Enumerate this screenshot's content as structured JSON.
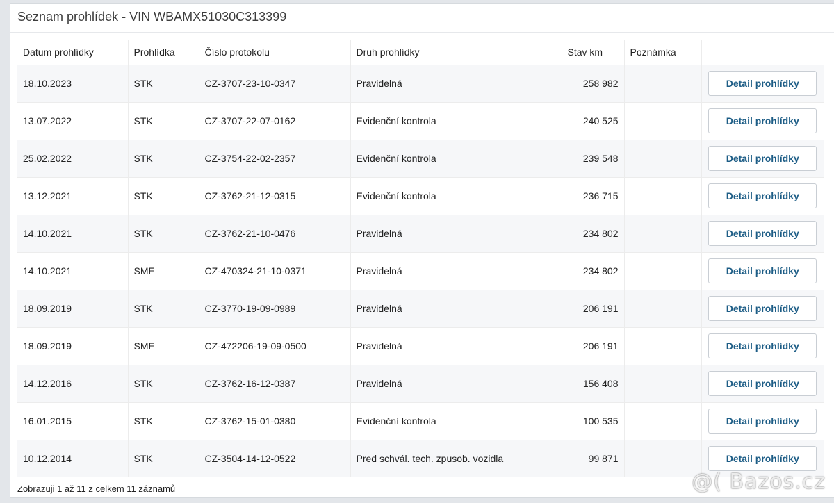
{
  "panel": {
    "title": "Seznam prohlídek - VIN WBAMX51030C313399"
  },
  "table": {
    "headers": [
      "Datum prohlídky",
      "Prohlídka",
      "Číslo protokolu",
      "Druh prohlídky",
      "Stav km",
      "Poznámka",
      ""
    ],
    "rows": [
      {
        "date": "18.10.2023",
        "type": "STK",
        "protocol": "CZ-3707-23-10-0347",
        "kind": "Pravidelná",
        "km": "258 982",
        "note": "",
        "action": "Detail prohlídky"
      },
      {
        "date": "13.07.2022",
        "type": "STK",
        "protocol": "CZ-3707-22-07-0162",
        "kind": "Evidenční kontrola",
        "km": "240 525",
        "note": "",
        "action": "Detail prohlídky"
      },
      {
        "date": "25.02.2022",
        "type": "STK",
        "protocol": "CZ-3754-22-02-2357",
        "kind": "Evidenční kontrola",
        "km": "239 548",
        "note": "",
        "action": "Detail prohlídky"
      },
      {
        "date": "13.12.2021",
        "type": "STK",
        "protocol": "CZ-3762-21-12-0315",
        "kind": "Evidenční kontrola",
        "km": "236 715",
        "note": "",
        "action": "Detail prohlídky"
      },
      {
        "date": "14.10.2021",
        "type": "STK",
        "protocol": "CZ-3762-21-10-0476",
        "kind": "Pravidelná",
        "km": "234 802",
        "note": "",
        "action": "Detail prohlídky"
      },
      {
        "date": "14.10.2021",
        "type": "SME",
        "protocol": "CZ-470324-21-10-0371",
        "kind": "Pravidelná",
        "km": "234 802",
        "note": "",
        "action": "Detail prohlídky"
      },
      {
        "date": "18.09.2019",
        "type": "STK",
        "protocol": "CZ-3770-19-09-0989",
        "kind": "Pravidelná",
        "km": "206 191",
        "note": "",
        "action": "Detail prohlídky"
      },
      {
        "date": "18.09.2019",
        "type": "SME",
        "protocol": "CZ-472206-19-09-0500",
        "kind": "Pravidelná",
        "km": "206 191",
        "note": "",
        "action": "Detail prohlídky"
      },
      {
        "date": "14.12.2016",
        "type": "STK",
        "protocol": "CZ-3762-16-12-0387",
        "kind": "Pravidelná",
        "km": "156 408",
        "note": "",
        "action": "Detail prohlídky"
      },
      {
        "date": "16.01.2015",
        "type": "STK",
        "protocol": "CZ-3762-15-01-0380",
        "kind": "Evidenční kontrola",
        "km": "100 535",
        "note": "",
        "action": "Detail prohlídky"
      },
      {
        "date": "10.12.2014",
        "type": "STK",
        "protocol": "CZ-3504-14-12-0522",
        "kind": "Pred schvál. tech. zpusob. vozidla",
        "km": "99 871",
        "note": "",
        "action": "Detail prohlídky"
      }
    ]
  },
  "footer": {
    "info": "Zobrazuji 1 až 11 z celkem 11 záznamů"
  },
  "watermark": {
    "text": "@( Bazos.cz"
  },
  "colors": {
    "button_text": "#1d5d86",
    "row_stripe": "#f6f7f9",
    "page_background": "#e3e6ea"
  }
}
